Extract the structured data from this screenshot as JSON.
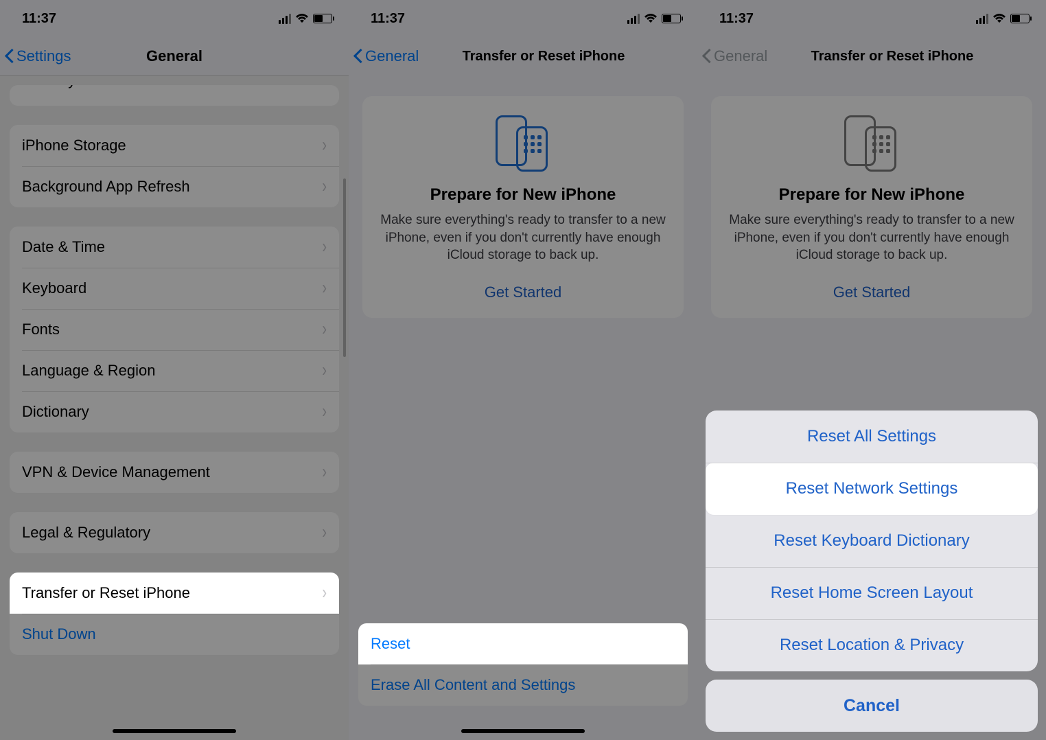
{
  "status": {
    "time": "11:37"
  },
  "screen1": {
    "back_label": "Settings",
    "title": "General",
    "group_cut": [
      "CarPlay"
    ],
    "group_storage": [
      "iPhone Storage",
      "Background App Refresh"
    ],
    "group_system": [
      "Date & Time",
      "Keyboard",
      "Fonts",
      "Language & Region",
      "Dictionary"
    ],
    "group_vpn": [
      "VPN & Device Management"
    ],
    "group_legal": [
      "Legal & Regulatory"
    ],
    "group_reset": [
      {
        "label": "Transfer or Reset iPhone",
        "highlight": true
      },
      {
        "label": "Shut Down",
        "blue": true
      }
    ]
  },
  "screen2": {
    "back_label": "General",
    "title": "Transfer or Reset iPhone",
    "prep": {
      "title": "Prepare for New iPhone",
      "desc": "Make sure everything's ready to transfer to a new iPhone, even if you don't currently have enough iCloud storage to back up.",
      "link": "Get Started"
    },
    "bottom": [
      {
        "label": "Reset",
        "highlight": true
      },
      {
        "label": "Erase All Content and Settings"
      }
    ]
  },
  "screen3": {
    "back_label": "General",
    "title": "Transfer or Reset iPhone",
    "prep": {
      "title": "Prepare for New iPhone",
      "desc": "Make sure everything's ready to transfer to a new iPhone, even if you don't currently have enough iCloud storage to back up.",
      "link": "Get Started"
    },
    "sheet": {
      "options": [
        "Reset All Settings",
        "Reset Network Settings",
        "Reset Keyboard Dictionary",
        "Reset Home Screen Layout",
        "Reset Location & Privacy"
      ],
      "highlight_index": 1,
      "cancel": "Cancel"
    }
  }
}
